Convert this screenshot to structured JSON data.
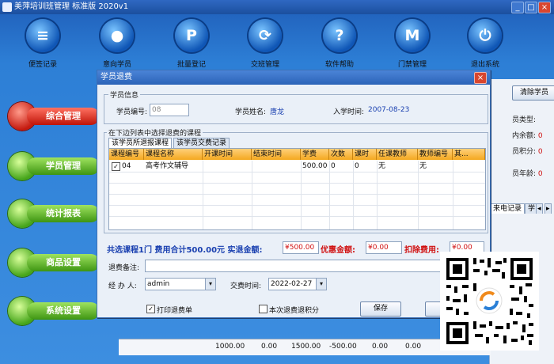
{
  "window": {
    "title": "美萍培训班管理 标准版  2020v1",
    "min": "_",
    "max": "□",
    "close": "×"
  },
  "toolbar": [
    {
      "icon": "note-icon",
      "glyph": "≡",
      "label": "便签记录"
    },
    {
      "icon": "student-icon",
      "glyph": "●",
      "label": "意向学员"
    },
    {
      "icon": "p-icon",
      "glyph": "P",
      "label": "批量登记"
    },
    {
      "icon": "sync-icon",
      "glyph": "⟳",
      "label": "交班管理"
    },
    {
      "icon": "help-icon",
      "glyph": "?",
      "label": "软件帮助"
    },
    {
      "icon": "m-icon",
      "glyph": "M",
      "label": "门禁管理"
    },
    {
      "icon": "power-icon",
      "glyph": "⏻",
      "label": "退出系统"
    }
  ],
  "sidebar": [
    {
      "label": "综合管理",
      "active": true
    },
    {
      "label": "学员管理",
      "active": false
    },
    {
      "label": "统计报表",
      "active": false
    },
    {
      "label": "商品设置",
      "active": false
    },
    {
      "label": "系统设置",
      "active": false
    }
  ],
  "right_panel": {
    "clear_button": "清除学员",
    "lines": [
      {
        "label": "员类型:",
        "value": ""
      },
      {
        "label": "内余额:",
        "value": "0"
      },
      {
        "label": "员积分:",
        "value": "0"
      },
      {
        "label": "员年龄:",
        "value": "0"
      }
    ],
    "tab": "来电记录",
    "tab2": "学"
  },
  "bottom_row": [
    "1000.00",
    "0.00",
    "1500.00",
    "-500.00",
    "0.00",
    "0.00"
  ],
  "dialog": {
    "title": "学员退费",
    "close": "×",
    "student_info_legend": "学员信息",
    "student_id_label": "学员编号:",
    "student_id_value": "08",
    "student_name_label": "学员姓名:",
    "student_name_value": "唐龙",
    "enroll_time_label": "入学时间:",
    "enroll_time_value": "2007-08-23",
    "course_legend": "在下边列表中选择退费的课程",
    "tabs": [
      "该学员所退报课程",
      "该学员交费记录"
    ],
    "columns": [
      "课程编号",
      "课程名称",
      "开课时间",
      "结束时间",
      "学费",
      "次数",
      "课时",
      "任课教师",
      "教师编号",
      "其..."
    ],
    "rows": [
      {
        "checked": "✓",
        "cells": [
          "04",
          "高考作文辅导",
          "",
          "",
          "500.00",
          "0",
          "0",
          "无",
          "无",
          ""
        ]
      }
    ],
    "summary_text": "共选课程1门  费用合计500.00元  实退金额:",
    "refund_value": "¥500.00",
    "discount_label": "优惠金额:",
    "discount_value": "¥0.00",
    "deduct_label": "扣除费用:",
    "deduct_value": "¥0.00",
    "remark_label": "退费备注:",
    "operator_label": "经 办 人:",
    "operator_value": "admin",
    "trade_time_label": "交费时间:",
    "trade_time_value": "2022-02-27",
    "print_label": "打印退费单",
    "print_checked": "✓",
    "points_label": "本次退费退积分",
    "save_button": "保存"
  },
  "colors": {
    "accent": "#2b63b8",
    "money": "#d01010",
    "header": "#f4a81f",
    "active_nav": "#c51a0f",
    "nav": "#46a51a"
  }
}
